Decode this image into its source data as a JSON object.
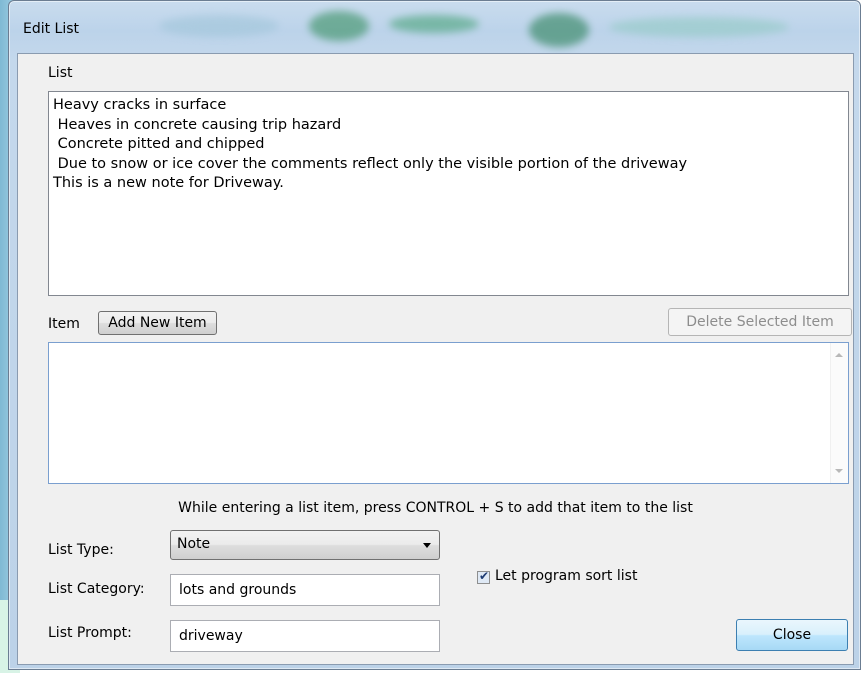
{
  "window": {
    "title": "Edit List"
  },
  "list_section": {
    "label": "List",
    "items": [
      "Heavy cracks in surface",
      " Heaves in concrete causing trip hazard",
      " Concrete pitted and chipped",
      " Due to snow or ice cover the comments reflect only the visible portion of the driveway",
      "This is a new note for Driveway."
    ]
  },
  "item_section": {
    "label": "Item",
    "add_button": "Add New Item",
    "delete_button": "Delete Selected Item",
    "value": ""
  },
  "hint": "While entering a list item, press CONTROL + S to add that item to the list",
  "form": {
    "list_type_label": "List Type:",
    "list_type_value": "Note",
    "list_category_label": "List Category:",
    "list_category_value": "lots and grounds",
    "list_prompt_label": "List Prompt:",
    "list_prompt_value": "driveway",
    "sort_checkbox_label": "Let program sort list",
    "sort_checked": true
  },
  "buttons": {
    "close": "Close"
  },
  "colors": {
    "title_bar": "#bcd3ea",
    "accent_button": "#bee6fd"
  }
}
